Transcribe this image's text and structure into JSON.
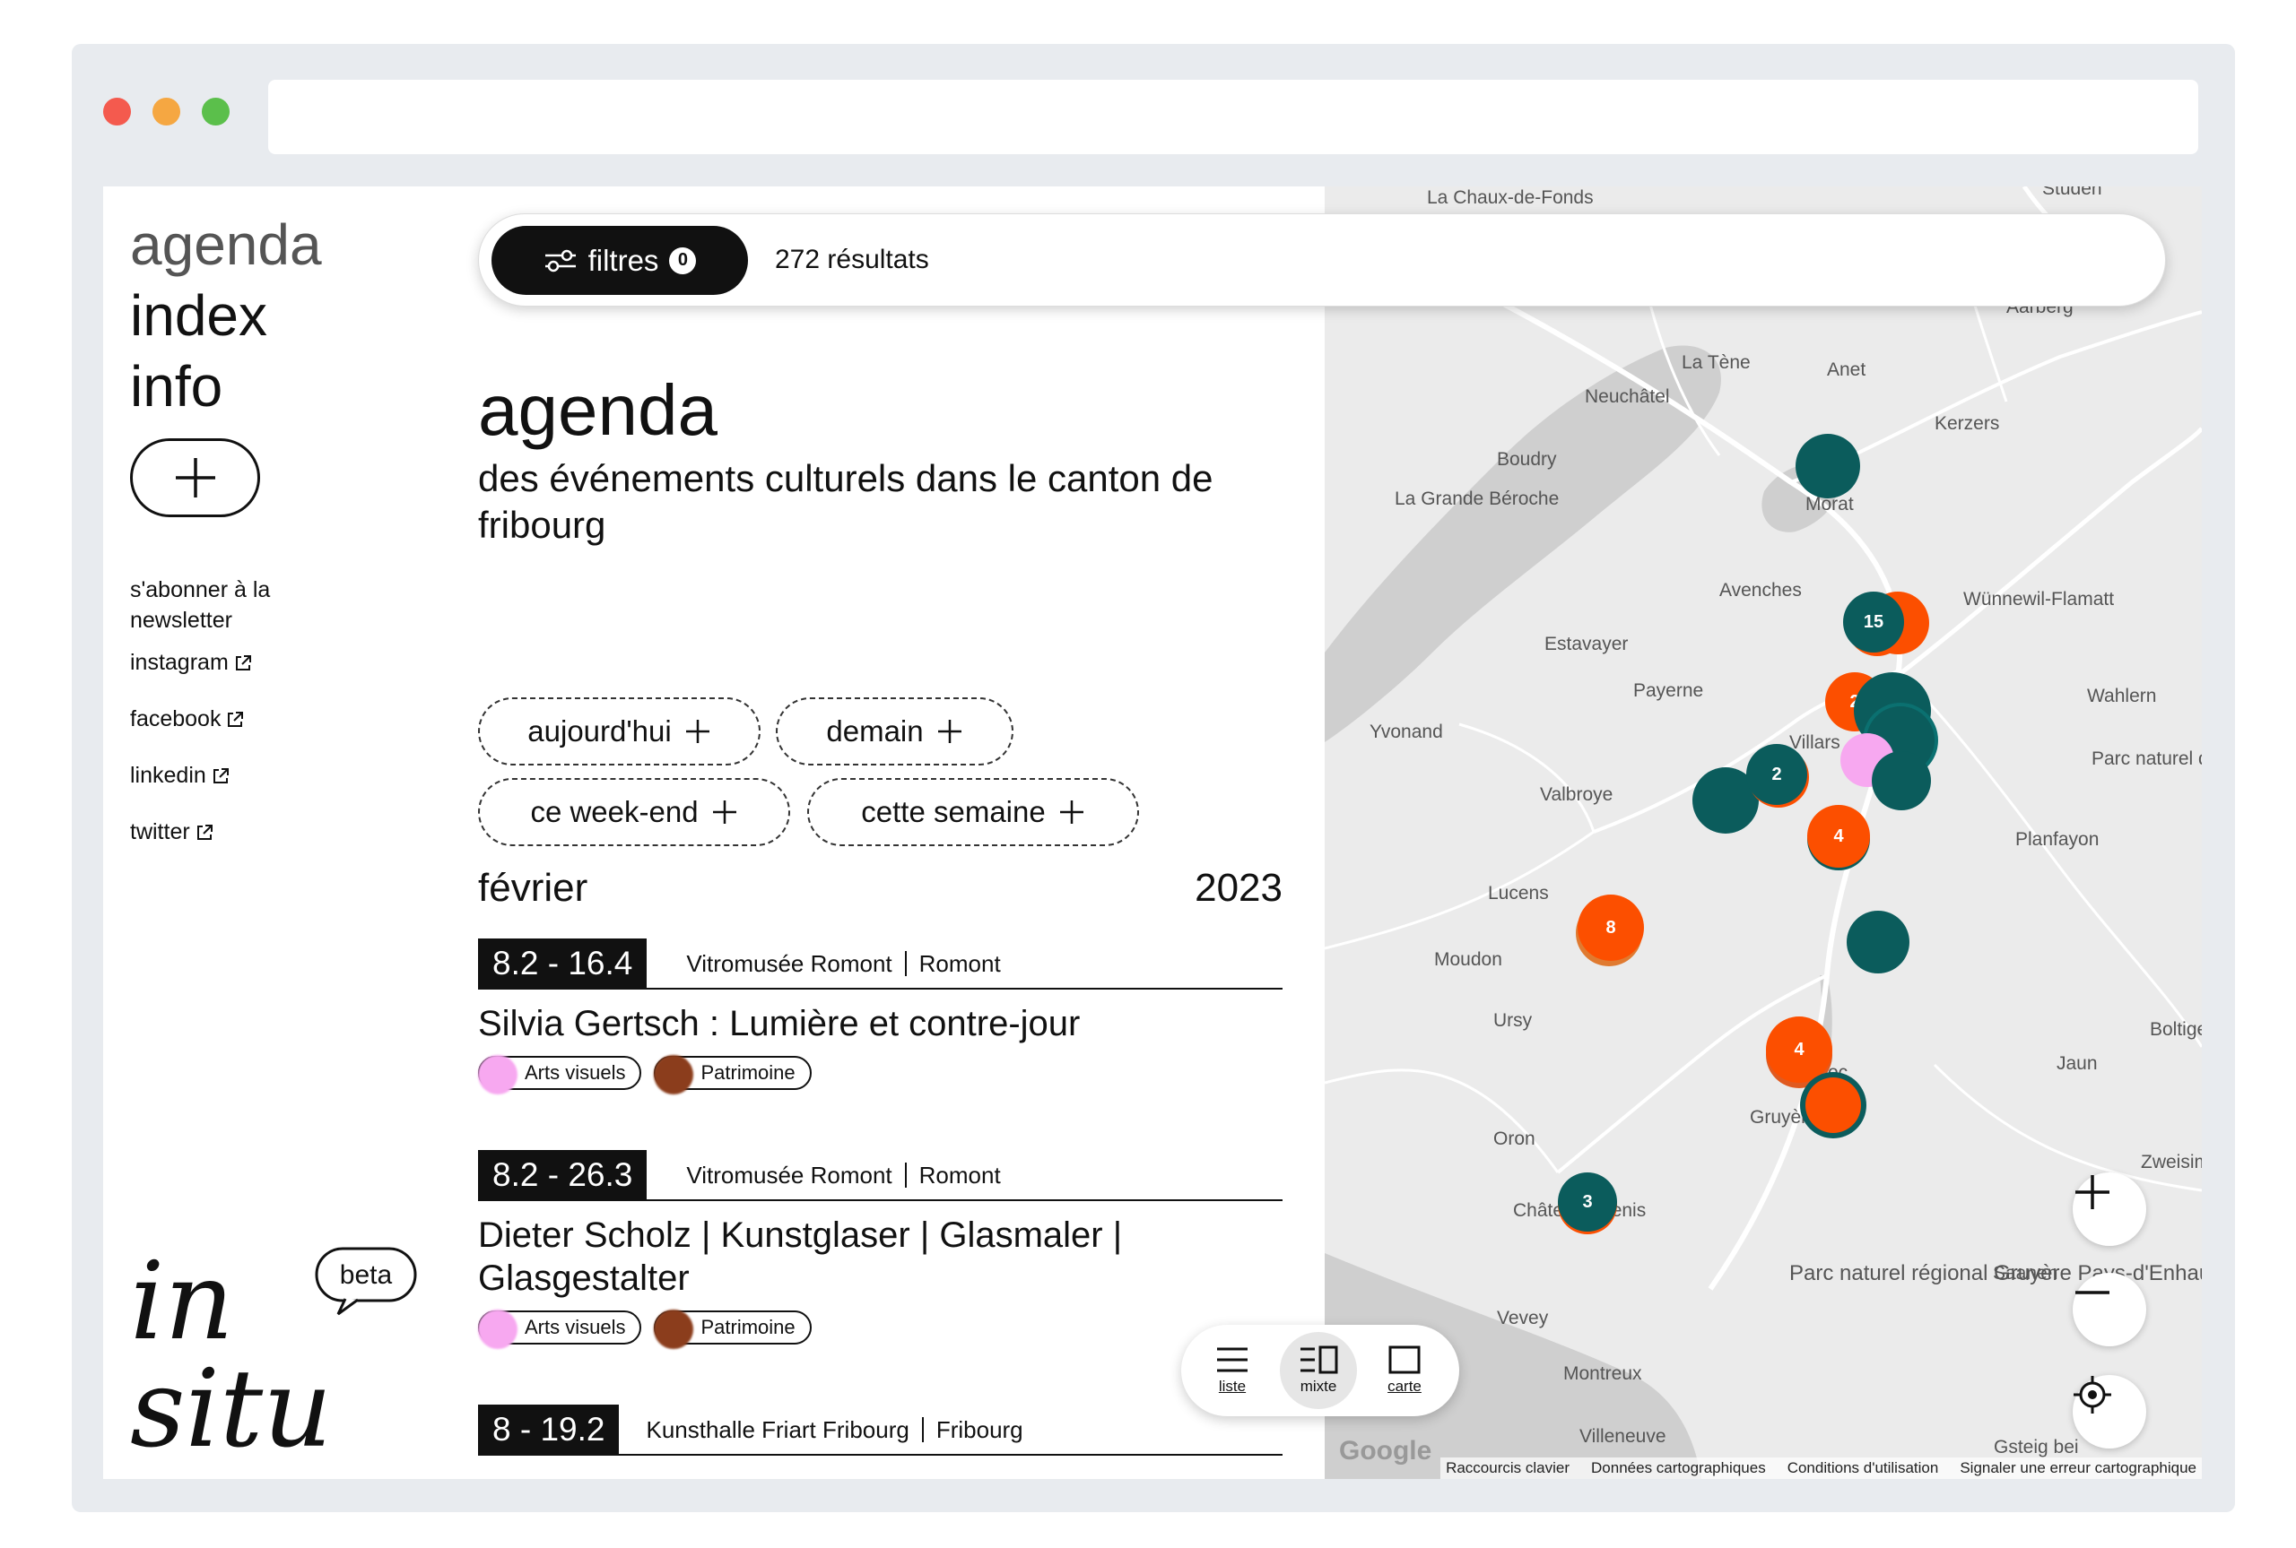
{
  "window": {
    "url": ""
  },
  "sidebar": {
    "nav": {
      "agenda": "agenda",
      "index": "index",
      "info": "info"
    },
    "newsletter": "s'abonner à la newsletter",
    "links": [
      {
        "label": "instagram"
      },
      {
        "label": "facebook"
      },
      {
        "label": "linkedin"
      },
      {
        "label": "twitter"
      }
    ],
    "logo": {
      "line1": "in",
      "line2": "situ",
      "badge": "beta"
    }
  },
  "filterbar": {
    "filters_label": "filtres",
    "filters_count": "0",
    "results": "272 résultats"
  },
  "header": {
    "title": "agenda",
    "subtitle": "des événements culturels dans le canton de fribourg"
  },
  "quick_filters": [
    "aujourd'hui",
    "demain",
    "ce week-end",
    "cette semaine"
  ],
  "month": {
    "name": "février",
    "year": "2023"
  },
  "events": [
    {
      "dates": "8.2 - 16.4",
      "venue": "Vitromusée Romont",
      "city": "Romont",
      "title": "Silvia Gertsch : Lumière et contre-jour",
      "tags": [
        {
          "label": "Arts visuels",
          "color": "#f7a8f0"
        },
        {
          "label": "Patrimoine",
          "color": "#8b3d1c"
        }
      ]
    },
    {
      "dates": "8.2 - 26.3",
      "venue": "Vitromusée Romont",
      "city": "Romont",
      "title": "Dieter Scholz | Kunstglaser | Glasmaler | Glasgestalter",
      "tags": [
        {
          "label": "Arts visuels",
          "color": "#f7a8f0"
        },
        {
          "label": "Patrimoine",
          "color": "#8b3d1c"
        }
      ]
    },
    {
      "dates": "8 - 19.2",
      "venue": "Kunsthalle Friart Fribourg",
      "city": "Fribourg",
      "title": "",
      "tags": []
    }
  ],
  "view_toggle": {
    "list": "liste",
    "mixed": "mixte",
    "map": "carte",
    "active": "mixte"
  },
  "map": {
    "colors": {
      "teal": "#0b5c5c",
      "orange": "#fc4f00",
      "pink": "#f7a8f0",
      "brown": "#8b3d1c"
    },
    "places": [
      "La Chaux-de-Fonds",
      "Studen",
      "Aarberg",
      "La Tène",
      "Anet",
      "Neuchâtel",
      "Kerzers",
      "Boudry",
      "La Grande Béroche",
      "Morat",
      "Avenches",
      "Wünnewil-Flamatt",
      "Estavayer",
      "Payerne",
      "Villars",
      "Wahlern",
      "Yvonand",
      "Parc naturel du Gantrisch",
      "Valbroye",
      "Planfayon",
      "Lucens",
      "Moudon",
      "Ursy",
      "Boltigen",
      "Broc",
      "Jaun",
      "Gruyères",
      "Oron",
      "Châtel-St-Denis",
      "Parc naturel régional Gruyère Pays-d'Enhaut",
      "Saanen",
      "Vevey",
      "Montreux",
      "Villeneuve",
      "Gsteig bei",
      "Zweisimmen"
    ],
    "clusters": [
      {
        "label": "15",
        "color": "teal"
      },
      {
        "label": "2",
        "color": "teal"
      },
      {
        "label": "4",
        "color": "orange"
      },
      {
        "label": "8",
        "color": "orange"
      },
      {
        "label": "4",
        "color": "orange"
      },
      {
        "label": "3",
        "color": "teal"
      },
      {
        "label": "2",
        "color": "orange"
      }
    ],
    "attribution": [
      "Raccourcis clavier",
      "Données cartographiques",
      "Conditions d'utilisation",
      "Signaler une erreur cartographique"
    ],
    "google": "Google"
  }
}
